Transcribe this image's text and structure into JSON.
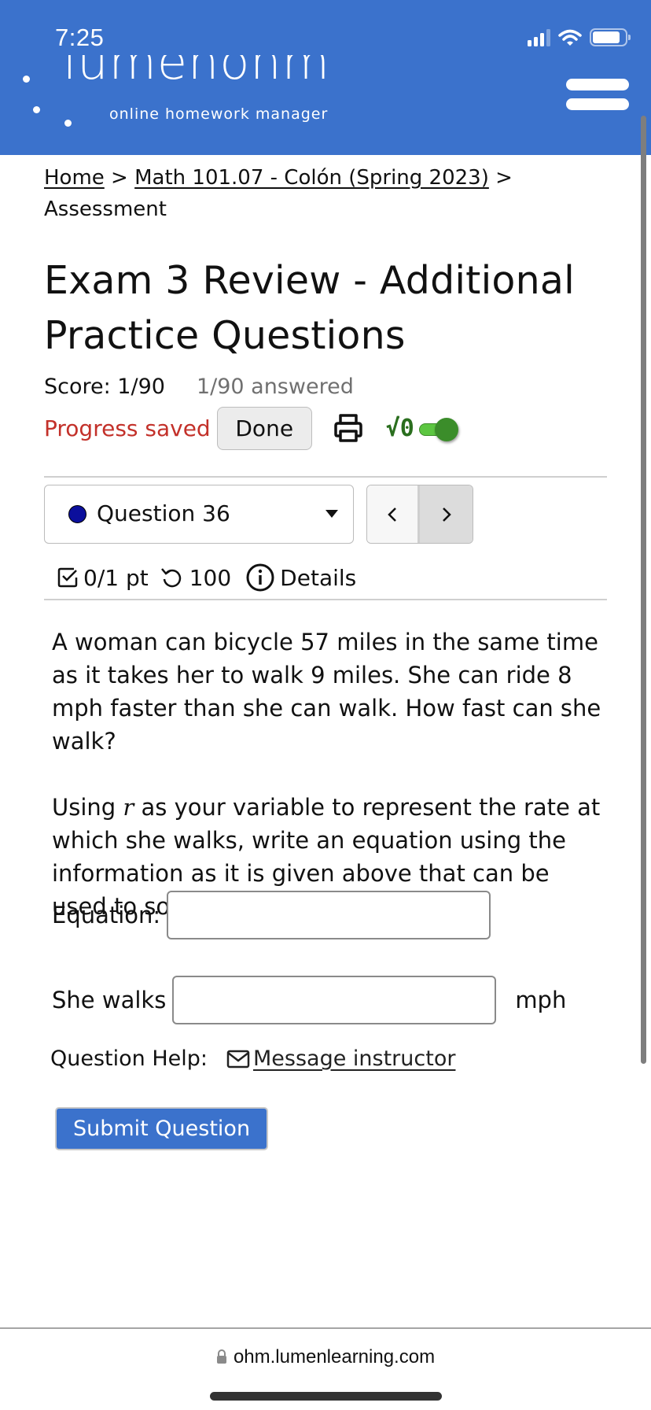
{
  "status_bar": {
    "time": "7:25",
    "icons": [
      "signal-icon",
      "wifi-icon",
      "battery-icon"
    ]
  },
  "header": {
    "logo_text": "lumenohm",
    "logo_subtitle": "online homework manager",
    "menu_icon": "hamburger-menu-icon"
  },
  "breadcrumb": {
    "items": [
      {
        "label": "Home",
        "link": true
      },
      {
        "label": "Math 101.07 - Colón (Spring 2023)",
        "link": true
      },
      {
        "label": "Assessment",
        "link": false
      }
    ],
    "separator": ">"
  },
  "page": {
    "title": "Exam 3 Review - Additional Practice Questions",
    "score": "Score: 1/90",
    "answered": "1/90 answered",
    "progress_status": "Progress saved",
    "done_label": "Done",
    "print_icon": "printer-icon",
    "math_toggle_label": "√0",
    "math_toggle_on": true
  },
  "question_nav": {
    "selected": "Question 36",
    "status_dot_color": "#0b0f9c",
    "prev_label": "‹",
    "next_label": "›"
  },
  "question_meta": {
    "points": "0/1 pt",
    "retries": "100",
    "details": "Details"
  },
  "question": {
    "paragraph1": "A woman can bicycle 57 miles in the same time as it takes her to walk 9 miles. She can ride 8 mph faster than she can walk. How fast can she walk?",
    "paragraph2_before": "Using ",
    "variable": "r",
    "paragraph2_after": " as your variable to represent the rate at which she walks, write an equation using the information as it is given above that can be used to solve this problem.",
    "equation_label": "Equation:",
    "equation_value": "",
    "walks_label": "She walks",
    "walks_value": "",
    "walks_unit": "mph"
  },
  "help": {
    "label": "Question Help:",
    "message_link": "Message instructor"
  },
  "submit_label": "Submit Question",
  "browser": {
    "url": "ohm.lumenlearning.com"
  },
  "colors": {
    "brand_blue": "#3b72cc",
    "saved_red": "#c3312a",
    "toggle_green": "#5cc641",
    "sqrt_green": "#2a6e1e"
  }
}
